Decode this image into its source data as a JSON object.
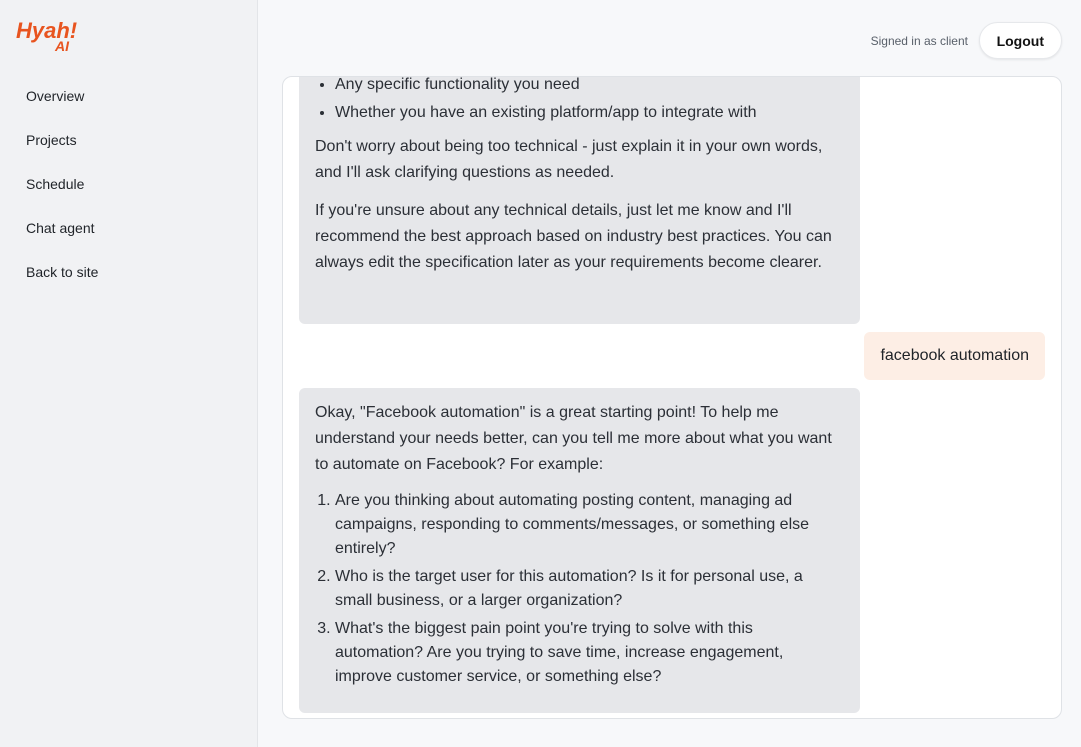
{
  "brand": {
    "logo_text": "Hyah!",
    "logo_sub": "AI",
    "accent": "#e8541f"
  },
  "sidebar": {
    "items": [
      {
        "label": "Overview"
      },
      {
        "label": "Projects"
      },
      {
        "label": "Schedule"
      },
      {
        "label": "Chat agent"
      },
      {
        "label": "Back to site"
      }
    ]
  },
  "header": {
    "signed_in_text": "Signed in as client",
    "logout_label": "Logout"
  },
  "chat": {
    "messages": [
      {
        "role": "assistant",
        "bullets": [
          "Any specific functionality you need",
          "Whether you have an existing platform/app to integrate with"
        ],
        "paragraphs": [
          "Don't worry about being too technical - just explain it in your own words, and I'll ask clarifying questions as needed.",
          "If you're unsure about any technical details, just let me know and I'll recommend the best approach based on industry best practices. You can always edit the specification later as your requirements become clearer."
        ]
      },
      {
        "role": "user",
        "text": "facebook automation"
      },
      {
        "role": "assistant",
        "intro": "Okay, \"Facebook automation\" is a great starting point! To help me understand your needs better, can you tell me more about what you want to automate on Facebook? For example:",
        "numbered": [
          "Are you thinking about automating posting content, managing ad campaigns, responding to comments/messages, or something else entirely?",
          "Who is the target user for this automation? Is it for personal use, a small business, or a larger organization?",
          "What's the biggest pain point you're trying to solve with this automation? Are you trying to save time, increase engagement, improve customer service, or something else?"
        ]
      }
    ]
  }
}
